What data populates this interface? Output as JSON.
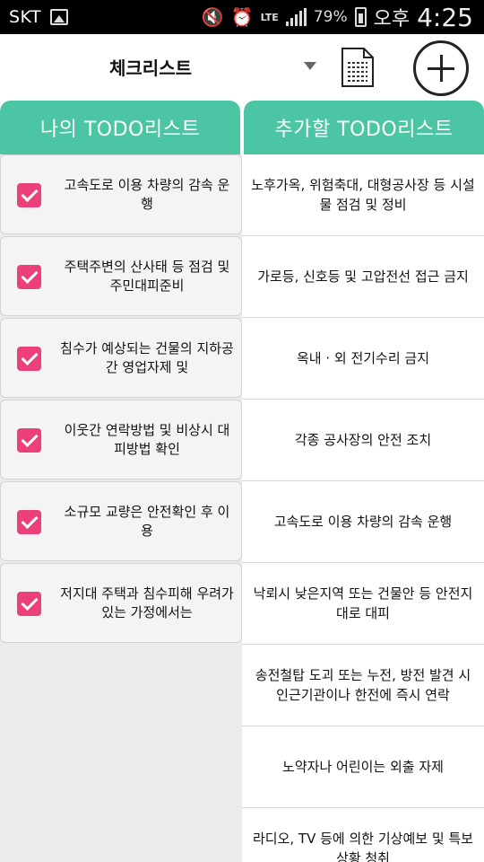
{
  "status_bar": {
    "carrier": "SKT",
    "battery": "79%",
    "ampm": "오후",
    "time": "4:25",
    "network": "LTE"
  },
  "toolbar": {
    "select_value": "체크리스트",
    "doc_icon": "document-icon",
    "add_icon": "plus-circle-icon"
  },
  "headers": {
    "my_list": "나의 TODO리스트",
    "add_list": "추가할 TODO리스트"
  },
  "my_todos": [
    {
      "text": "고속도로 이용 차량의 감속 운행",
      "checked": true
    },
    {
      "text": "주택주변의 산사태 등 점검 및 주민대피준비",
      "checked": true
    },
    {
      "text": "침수가 예상되는 건물의 지하공간 영업자제 및",
      "checked": true
    },
    {
      "text": "이웃간 연락방법 및 비상시 대피방법 확인",
      "checked": true
    },
    {
      "text": "소규모 교량은 안전확인 후 이용",
      "checked": true
    },
    {
      "text": "저지대 주택과 침수피해 우려가 있는 가정에서는",
      "checked": true
    }
  ],
  "suggested_todos": [
    "노후가옥, 위험축대, 대형공사장 등 시설물 점검 및 정비",
    "가로등, 신호등 및 고압전선 접근 금지",
    "옥내 · 외 전기수리 금지",
    "각종 공사장의 안전 조치",
    "고속도로 이용 차량의 감속 운행",
    "낙뢰시 낮은지역 또는 건물안 등 안전지대로 대피",
    "송전철탑 도괴 또는 누전, 방전 발견 시 인근기관이나 한전에 즉시 연락",
    "노약자나 어린이는 외출 자제",
    "라디오, TV 등에 의한 기상예보 및 특보상황 청취"
  ],
  "colors": {
    "accent": "#4cc5a5",
    "checkbox": "#ec407a"
  }
}
